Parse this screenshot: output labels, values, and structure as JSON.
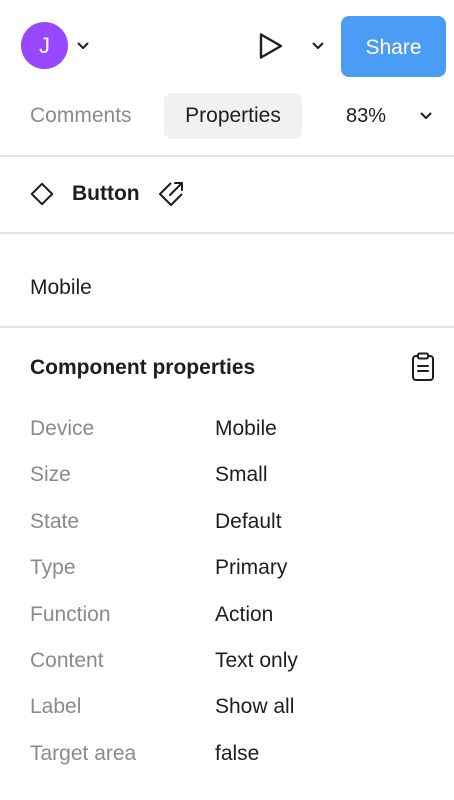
{
  "header": {
    "avatar_initial": "J",
    "avatar_color": "#9747ff",
    "share_label": "Share",
    "share_color": "#4a9cf5",
    "icons": [
      "chevron-down-icon",
      "play-icon"
    ]
  },
  "tabs": [
    {
      "label": "Comments",
      "active": false
    },
    {
      "label": "Properties",
      "active": true
    }
  ],
  "zoom": {
    "value": "83%"
  },
  "component": {
    "name": "Button",
    "icons": [
      "diamond-icon",
      "link-icon"
    ]
  },
  "variant": {
    "label": "Mobile"
  },
  "properties": {
    "title": "Component properties",
    "icon": "clipboard-icon",
    "rows": [
      {
        "key": "Device",
        "value": "Mobile"
      },
      {
        "key": "Size",
        "value": "Small"
      },
      {
        "key": "State",
        "value": "Default"
      },
      {
        "key": "Type",
        "value": "Primary"
      },
      {
        "key": "Function",
        "value": "Action"
      },
      {
        "key": "Content",
        "value": "Text only"
      },
      {
        "key": "Label",
        "value": "Show all"
      },
      {
        "key": "Target area",
        "value": "false"
      }
    ]
  }
}
